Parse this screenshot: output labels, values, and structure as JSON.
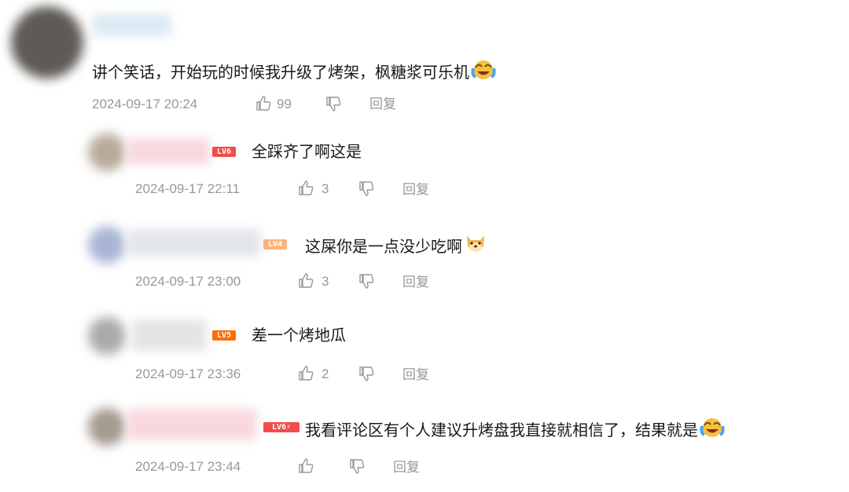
{
  "comment": {
    "text": "讲个笑话，开始玩的时候我升级了烤架，枫糖浆可乐机",
    "time": "2024-09-17 20:24",
    "likes": "99",
    "reply_label": "回复"
  },
  "replies": [
    {
      "level": "LV6",
      "text": "全踩齐了啊这是",
      "time": "2024-09-17 22:11",
      "likes": "3",
      "reply_label": "回复"
    },
    {
      "level": "LV4",
      "text": "这屎你是一点没少吃啊",
      "time": "2024-09-17 23:00",
      "likes": "3",
      "reply_label": "回复"
    },
    {
      "level": "LV5",
      "text": "差一个烤地瓜",
      "time": "2024-09-17 23:36",
      "likes": "2",
      "reply_label": "回复"
    },
    {
      "level": "LV6",
      "text": "我看评论区有个人建议升烤盘我直接就相信了，结果就是",
      "time": "2024-09-17 23:44",
      "likes": "",
      "reply_label": "回复"
    }
  ],
  "colors": {
    "lv6": "#f04c49",
    "lv5": "#ff6c00",
    "lv4": "#ffb37c",
    "meta": "#9499a0"
  }
}
